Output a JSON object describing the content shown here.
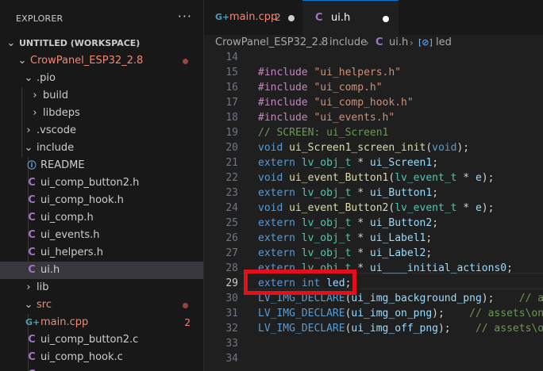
{
  "explorer": {
    "title": "EXPLORER",
    "more": "···",
    "tree": [
      {
        "label": "UNTITLED (WORKSPACE)",
        "chevron": "⌄",
        "bold": true
      },
      {
        "label": "CrowPanel_ESP32_2.8",
        "chevron": "⌄",
        "red": true,
        "dot": true
      },
      {
        "label": ".pio",
        "chevron": "⌄"
      },
      {
        "label": "build",
        "chevron": "›"
      },
      {
        "label": "libdeps",
        "chevron": "›"
      },
      {
        "label": ".vscode",
        "chevron": "›"
      },
      {
        "label": "include",
        "chevron": "⌄"
      },
      {
        "label": "README",
        "icon": "info-icon",
        "glyph": "ⓘ"
      },
      {
        "label": "ui_comp_button2.h",
        "icon": "c-file-icon",
        "glyph": "C"
      },
      {
        "label": "ui_comp_hook.h",
        "icon": "c-file-icon",
        "glyph": "C"
      },
      {
        "label": "ui_comp.h",
        "icon": "c-file-icon",
        "glyph": "C"
      },
      {
        "label": "ui_events.h",
        "icon": "c-file-icon",
        "glyph": "C"
      },
      {
        "label": "ui_helpers.h",
        "icon": "c-file-icon",
        "glyph": "C"
      },
      {
        "label": "ui.h",
        "icon": "c-file-icon",
        "glyph": "C",
        "selected": true
      },
      {
        "label": "lib",
        "chevron": "›"
      },
      {
        "label": "src",
        "chevron": "⌄",
        "red": true,
        "dot": true
      },
      {
        "label": "main.cpp",
        "icon": "cpp-file-icon",
        "glyph": "G+",
        "red": true,
        "badge": "2"
      },
      {
        "label": "ui_comp_button2.c",
        "icon": "c-file-icon",
        "glyph": "C"
      },
      {
        "label": "ui_comp_hook.c",
        "icon": "c-file-icon",
        "glyph": "C"
      },
      {
        "label": "",
        "icon": "c-file-icon",
        "glyph": "C"
      }
    ]
  },
  "tabs": [
    {
      "label": "main.cpp",
      "icon_glyph": "G+",
      "count": "2",
      "modified": true
    },
    {
      "label": "ui.h",
      "icon_glyph": "C",
      "modified": true,
      "active": true
    }
  ],
  "breadcrumb": {
    "project": "CrowPanel_ESP32_2.8",
    "folder": "include",
    "file_icon": "C",
    "file": "ui.h",
    "symbol_icon": "[⊘]",
    "symbol": "led",
    "separator": "›"
  },
  "editor": {
    "active_line": 29,
    "lines": [
      {
        "n": "14",
        "tokens": []
      },
      {
        "n": "15",
        "tokens": [
          {
            "t": "#include ",
            "c": "pp"
          },
          {
            "t": "\"ui_helpers.h\"",
            "c": "str"
          }
        ]
      },
      {
        "n": "16",
        "tokens": [
          {
            "t": "#include ",
            "c": "pp"
          },
          {
            "t": "\"ui_comp.h\"",
            "c": "str"
          }
        ]
      },
      {
        "n": "17",
        "tokens": [
          {
            "t": "#include ",
            "c": "pp"
          },
          {
            "t": "\"ui_comp_hook.h\"",
            "c": "str"
          }
        ]
      },
      {
        "n": "18",
        "tokens": [
          {
            "t": "#include ",
            "c": "pp"
          },
          {
            "t": "\"ui_events.h\"",
            "c": "str"
          }
        ]
      },
      {
        "n": "19",
        "tokens": [
          {
            "t": "// SCREEN: ui_Screen1",
            "c": "com"
          }
        ]
      },
      {
        "n": "20",
        "tokens": [
          {
            "t": "void ",
            "c": "kw"
          },
          {
            "t": "ui_Screen1_screen_init",
            "c": "fn"
          },
          {
            "t": "(",
            "c": "plain"
          },
          {
            "t": "void",
            "c": "kw"
          },
          {
            "t": ");",
            "c": "plain"
          }
        ]
      },
      {
        "n": "21",
        "tokens": [
          {
            "t": "extern ",
            "c": "kw"
          },
          {
            "t": "lv_obj_t",
            "c": "type"
          },
          {
            "t": " * ",
            "c": "plain"
          },
          {
            "t": "ui_Screen1",
            "c": "var"
          },
          {
            "t": ";",
            "c": "plain"
          }
        ]
      },
      {
        "n": "22",
        "tokens": [
          {
            "t": "void ",
            "c": "kw"
          },
          {
            "t": "ui_event_Button1",
            "c": "fn"
          },
          {
            "t": "(",
            "c": "plain"
          },
          {
            "t": "lv_event_t",
            "c": "type"
          },
          {
            "t": " * ",
            "c": "plain"
          },
          {
            "t": "e",
            "c": "var"
          },
          {
            "t": ");",
            "c": "plain"
          }
        ]
      },
      {
        "n": "23",
        "tokens": [
          {
            "t": "extern ",
            "c": "kw"
          },
          {
            "t": "lv_obj_t",
            "c": "type"
          },
          {
            "t": " * ",
            "c": "plain"
          },
          {
            "t": "ui_Button1",
            "c": "var"
          },
          {
            "t": ";",
            "c": "plain"
          }
        ]
      },
      {
        "n": "24",
        "tokens": [
          {
            "t": "void ",
            "c": "kw"
          },
          {
            "t": "ui_event_Button2",
            "c": "fn"
          },
          {
            "t": "(",
            "c": "plain"
          },
          {
            "t": "lv_event_t",
            "c": "type"
          },
          {
            "t": " * ",
            "c": "plain"
          },
          {
            "t": "e",
            "c": "var"
          },
          {
            "t": ");",
            "c": "plain"
          }
        ]
      },
      {
        "n": "25",
        "tokens": [
          {
            "t": "extern ",
            "c": "kw"
          },
          {
            "t": "lv_obj_t",
            "c": "type"
          },
          {
            "t": " * ",
            "c": "plain"
          },
          {
            "t": "ui_Button2",
            "c": "var"
          },
          {
            "t": ";",
            "c": "plain"
          }
        ]
      },
      {
        "n": "26",
        "tokens": [
          {
            "t": "extern ",
            "c": "kw"
          },
          {
            "t": "lv_obj_t",
            "c": "type"
          },
          {
            "t": " * ",
            "c": "plain"
          },
          {
            "t": "ui_Label1",
            "c": "var"
          },
          {
            "t": ";",
            "c": "plain"
          }
        ]
      },
      {
        "n": "27",
        "tokens": [
          {
            "t": "extern ",
            "c": "kw"
          },
          {
            "t": "lv_obj_t",
            "c": "type"
          },
          {
            "t": " * ",
            "c": "plain"
          },
          {
            "t": "ui_Label2",
            "c": "var"
          },
          {
            "t": ";",
            "c": "plain"
          }
        ]
      },
      {
        "n": "28",
        "tokens": [
          {
            "t": "extern ",
            "c": "kw"
          },
          {
            "t": "lv_obj_t",
            "c": "type"
          },
          {
            "t": " * ",
            "c": "plain"
          },
          {
            "t": "ui____initial_actions0",
            "c": "var"
          },
          {
            "t": ";",
            "c": "plain"
          }
        ]
      },
      {
        "n": "29",
        "tokens": [
          {
            "t": "extern ",
            "c": "kw"
          },
          {
            "t": "int ",
            "c": "kw"
          },
          {
            "t": "led",
            "c": "var"
          },
          {
            "t": ";",
            "c": "plain"
          }
        ]
      },
      {
        "n": "30",
        "tokens": [
          {
            "t": "LV_IMG_DECLARE",
            "c": "mac"
          },
          {
            "t": "(",
            "c": "plain"
          },
          {
            "t": "ui_img_background_png",
            "c": "var"
          },
          {
            "t": ");    ",
            "c": "plain"
          },
          {
            "t": "// assets\\background.png",
            "c": "com"
          }
        ]
      },
      {
        "n": "31",
        "tokens": [
          {
            "t": "LV_IMG_DECLARE",
            "c": "mac"
          },
          {
            "t": "(",
            "c": "plain"
          },
          {
            "t": "ui_img_on_png",
            "c": "var"
          },
          {
            "t": ");    ",
            "c": "plain"
          },
          {
            "t": "// assets\\on.png",
            "c": "com"
          }
        ]
      },
      {
        "n": "32",
        "tokens": [
          {
            "t": "LV_IMG_DECLARE",
            "c": "mac"
          },
          {
            "t": "(",
            "c": "plain"
          },
          {
            "t": "ui_img_off_png",
            "c": "var"
          },
          {
            "t": ");    ",
            "c": "plain"
          },
          {
            "t": "// assets\\off.png",
            "c": "com"
          }
        ]
      },
      {
        "n": "33",
        "tokens": []
      },
      {
        "n": "34",
        "tokens": []
      }
    ]
  },
  "colors": {
    "accent": "#0078d4",
    "highlight_box": "#e3101b",
    "error_badge": "#f48771"
  }
}
